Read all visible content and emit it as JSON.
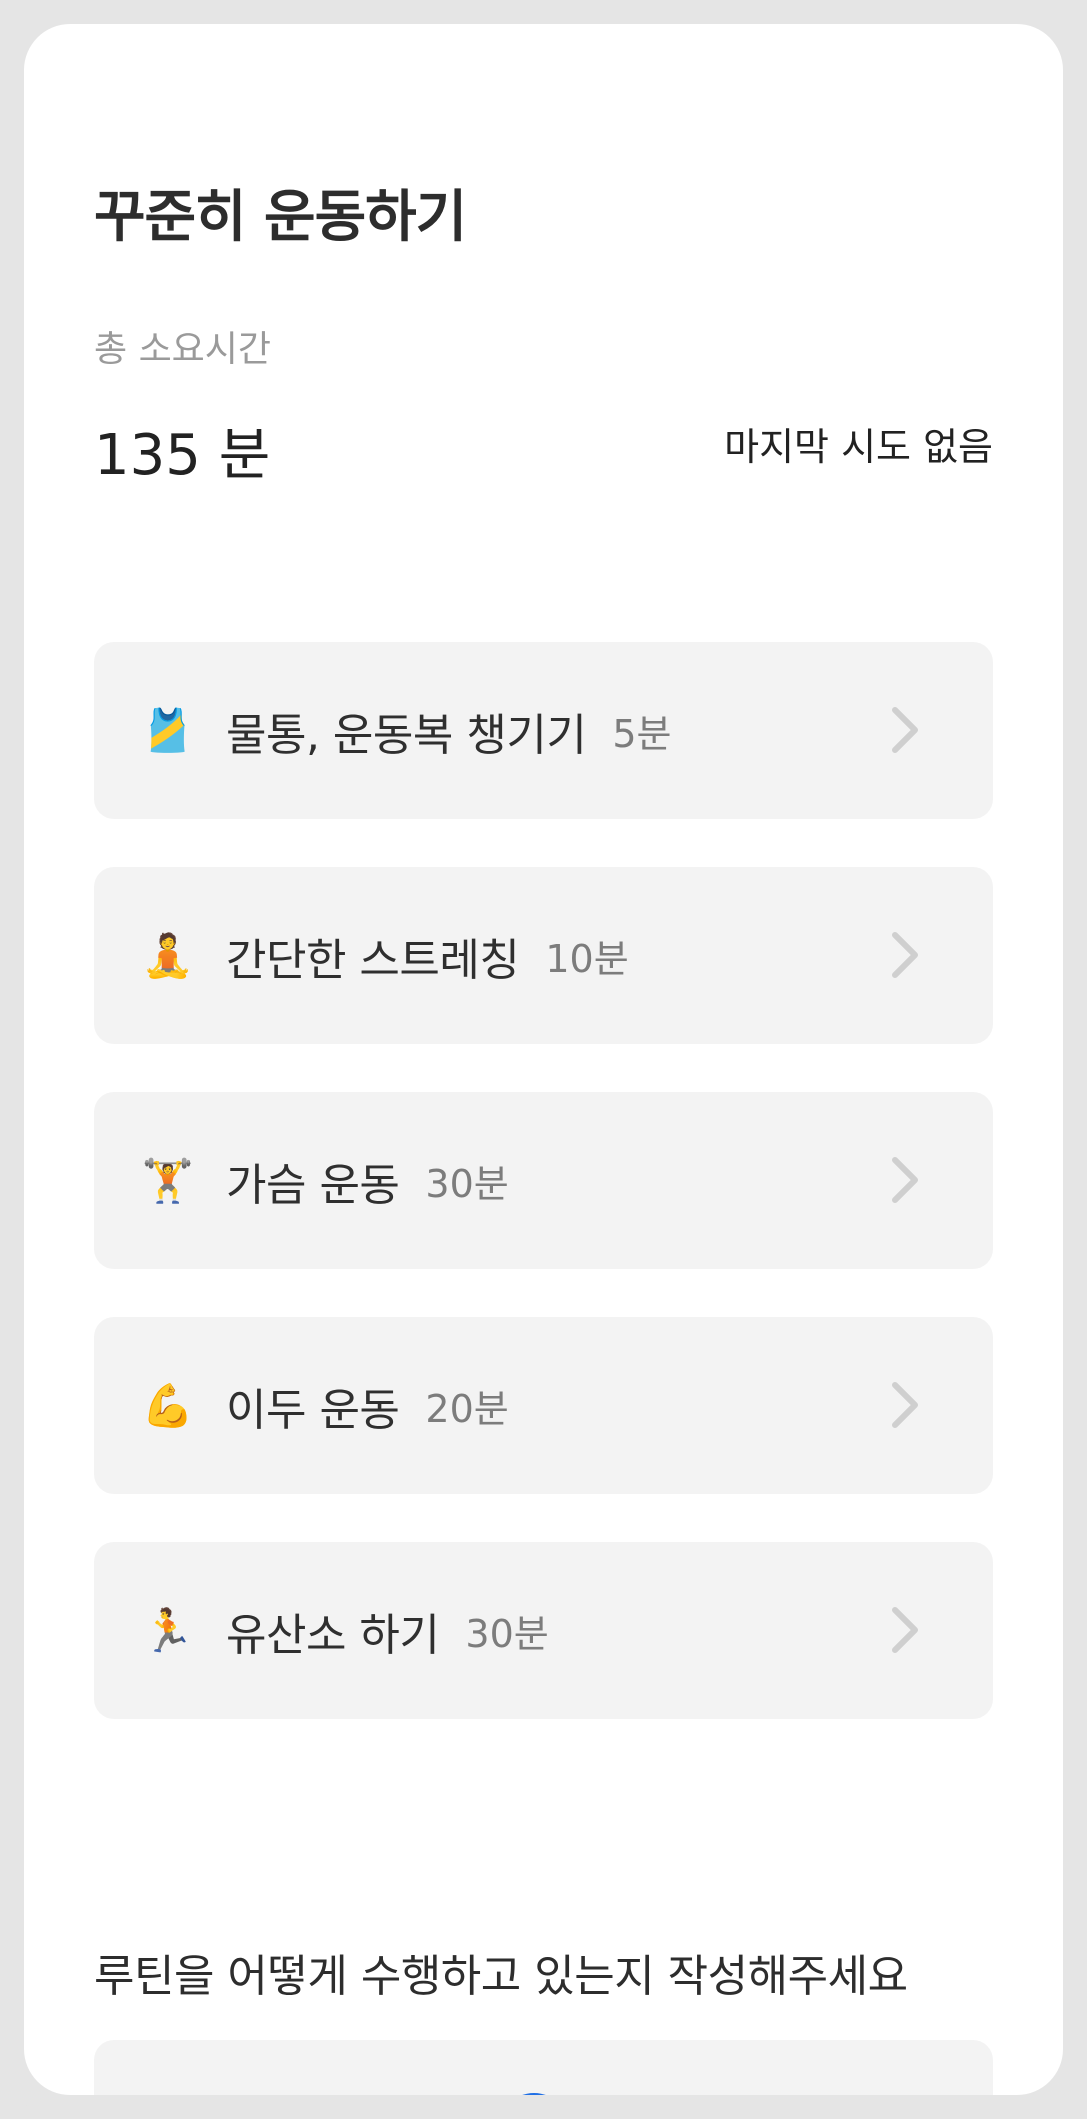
{
  "header": {
    "title": "꾸준히 운동하기",
    "total_label": "총 소요시간",
    "total_value": "135 분",
    "last_attempt": "마지막 시도 없음"
  },
  "routines": [
    {
      "emoji": "🎽",
      "icon": "running-shirt-icon",
      "label": "물통, 운동복 챙기기",
      "duration": "5분"
    },
    {
      "emoji": "🧘",
      "icon": "meditation-icon",
      "label": "간단한 스트레칭",
      "duration": "10분"
    },
    {
      "emoji": "🏋️",
      "icon": "weightlifter-icon",
      "label": "가슴 운동",
      "duration": "30분"
    },
    {
      "emoji": "💪",
      "icon": "flexed-biceps-icon",
      "label": "이두 운동",
      "duration": "20분"
    },
    {
      "emoji": "🏃",
      "icon": "runner-icon",
      "label": "유산소 하기",
      "duration": "30분"
    }
  ],
  "feedback": {
    "prompt": "루틴을 어떻게 수행하고 있는지 작성해주세요",
    "add_icon": "plus-icon"
  },
  "colors": {
    "accent": "#1f6fe5",
    "card_bg": "#f3f3f3",
    "muted_text": "#9a9a9a",
    "frame": "#e5e5e5"
  }
}
